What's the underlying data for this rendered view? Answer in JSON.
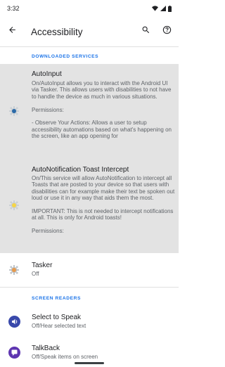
{
  "status_bar": {
    "time": "3:32",
    "icons": [
      "wifi-icon",
      "signal-icon",
      "battery-icon"
    ]
  },
  "app_bar": {
    "title": "Accessibility",
    "icons": [
      "back-arrow-icon",
      "search-icon",
      "help-icon"
    ]
  },
  "sections": {
    "downloaded": "DOWNLOADED SERVICES",
    "screen_readers": "SCREEN READERS"
  },
  "services": [
    {
      "name": "AutoInput",
      "description": "On/AutoInput allows you to interact with the Android UI via Tasker. This allows users with disabilities to not have to handle the device as much in various situations.\n\nPermissions:\n\n- Observe Your Actions: Allows a user to setup accessibility automations based on what's happening on the screen, like an app opening for",
      "icon": "autoinput-icon"
    },
    {
      "name": "AutoNotification Toast Intercept",
      "description": "On/This service will allow AutoNotification to intercept all Toasts that are posted to your device so that users with disabilities can for example make their text be spoken out loud or use it in any way that aids them the most.\n\nIMPORTANT: This is not needed to intercept notifications at all. This is only for Android toasts!\n\nPermissions:",
      "icon": "autonotification-icon"
    },
    {
      "name": "Tasker",
      "description": "Off",
      "icon": "tasker-icon"
    }
  ],
  "screen_readers": [
    {
      "name": "Select to Speak",
      "description": "Off/Hear selected text",
      "icon": "select-to-speak-icon"
    },
    {
      "name": "TalkBack",
      "description": "Off/Speak items on screen",
      "icon": "talkback-icon"
    }
  ],
  "colors": {
    "accent": "#1a73e8",
    "highlight": "#e3e3e3",
    "talkback": "#5e35b1",
    "select_to_speak": "#3949ab"
  }
}
